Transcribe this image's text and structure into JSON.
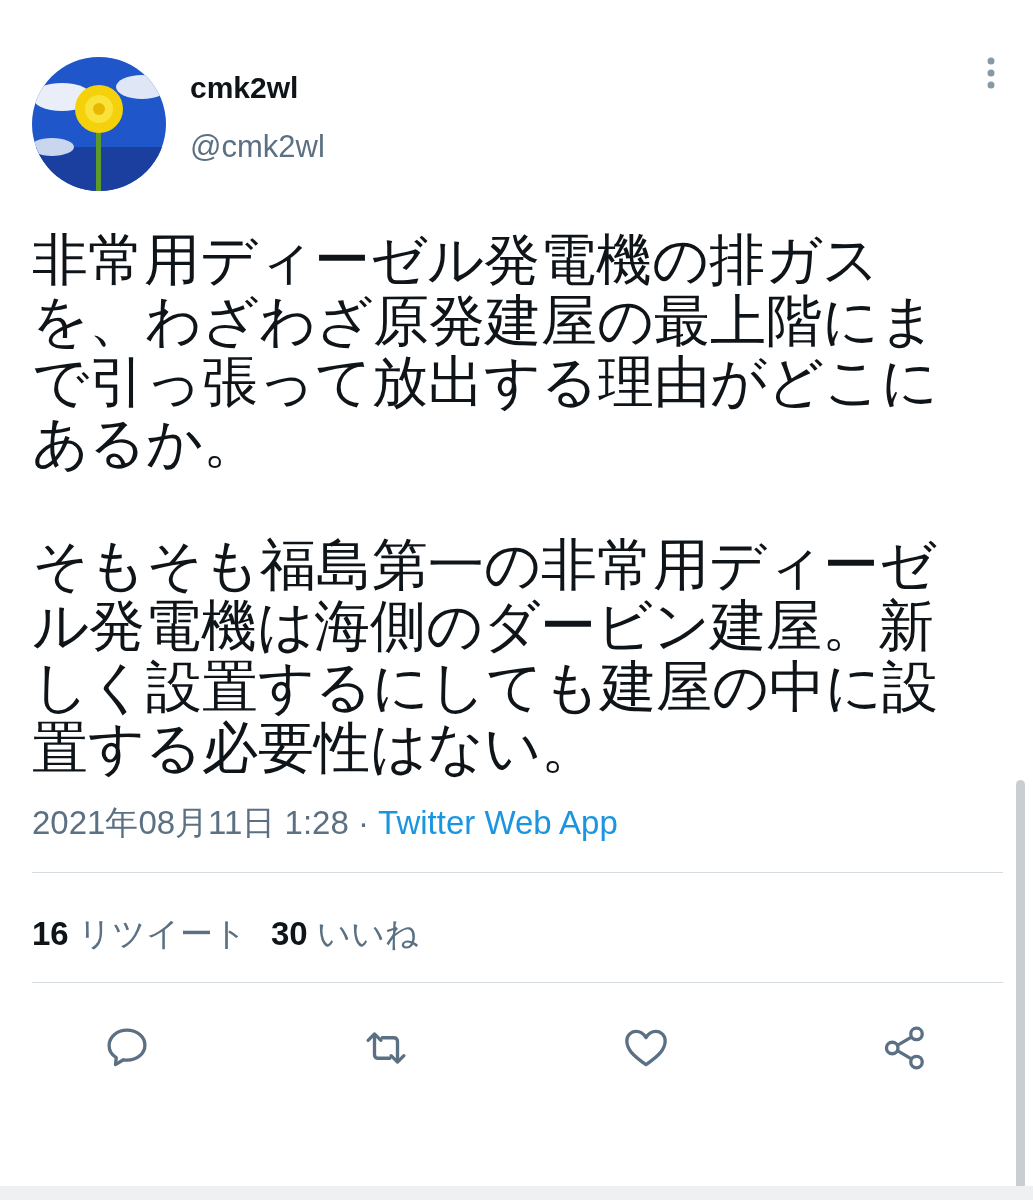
{
  "user": {
    "name": "cmk2wl",
    "handle": "@cmk2wl"
  },
  "tweet": {
    "paragraphs": [
      "非常用ディーゼル発電機の排ガスを、わざわざ原発建屋の最上階にまで引っ張って放出する理由がどこにあるか。",
      "そもそも福島第一の非常用ディーゼル発電機は海側のダービン建屋。新しく設置するにしても建屋の中に設置する必要性はない。"
    ]
  },
  "meta": {
    "timestamp": "2021年08月11日 1:28 ·",
    "source": "Twitter Web App"
  },
  "stats": [
    {
      "count": "16",
      "label": "リツイート"
    },
    {
      "count": "30",
      "label": "いいね"
    }
  ],
  "actions": [
    {
      "kind": "reply"
    },
    {
      "kind": "retweet"
    },
    {
      "kind": "like"
    },
    {
      "kind": "share"
    }
  ]
}
